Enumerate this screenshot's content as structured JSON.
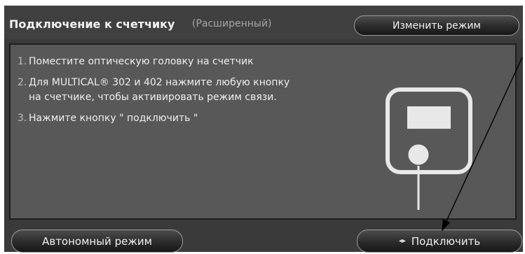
{
  "header": {
    "title": "Подключение к счетчику",
    "subtitle": "(Расширенный)",
    "change_mode_label": "Изменить режим"
  },
  "instructions": [
    {
      "num": "1.",
      "text": "Поместите оптическую головку на счетчик"
    },
    {
      "num": "2.",
      "text": "Для MULTICAL® 302 и 402 нажмите любую кнопку на счетчике, чтобы активировать режим связи."
    },
    {
      "num": "3.",
      "text": "Нажмите кнопку \" подключить \""
    }
  ],
  "footer": {
    "autonomous_mode_label": "Автономный режим",
    "connect_label": "Подключить",
    "connect_icon": "◂▸"
  },
  "colors": {
    "window_bg": "#3a3a3a",
    "panel_bg": "#585858",
    "text": "#efefef",
    "subtitle": "#a7a7a7",
    "annotation_arrow": "#000000"
  },
  "icons": {
    "meter": "meter-device-icon",
    "annotation": "annotation-arrow"
  }
}
